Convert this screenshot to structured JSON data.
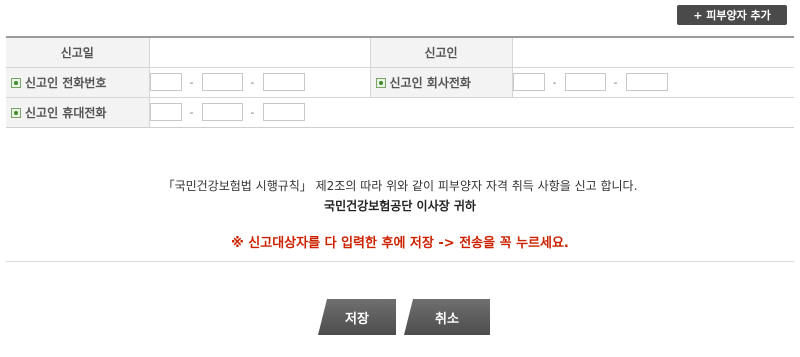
{
  "toolbar": {
    "add_dependent_label": "+ 피부양자 추가"
  },
  "form": {
    "report_date_label": "신고일",
    "report_date_value": "",
    "reporter_label": "신고인",
    "reporter_value": "",
    "reporter_phone_label": "신고인 전화번호",
    "reporter_office_phone_label": "신고인 회사전화",
    "reporter_mobile_label": "신고인 휴대전화",
    "phone_separator": "-",
    "reporter_phone": [
      "",
      "",
      ""
    ],
    "reporter_office_phone": [
      "",
      "",
      ""
    ],
    "reporter_mobile": [
      "",
      "",
      ""
    ]
  },
  "notice": {
    "legal_text": "「국민건강보험법 시행규칙」 제2조의 따라 위와 같이 피부양자 자격 취득 사항을 신고 합니다.",
    "recipient": "국민건강보험공단 이사장 귀하",
    "warning": "※ 신고대상자를 다 입력한 후에 저장 -> 전송을 꼭 누르세요."
  },
  "actions": {
    "save_label": "저장",
    "cancel_label": "취소"
  }
}
